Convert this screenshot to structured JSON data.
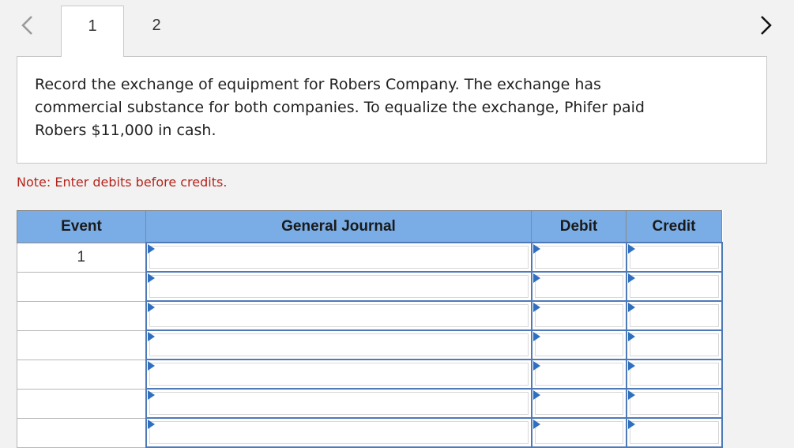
{
  "nav": {
    "prev_icon": "chevron-left-icon",
    "next_icon": "chevron-right-icon"
  },
  "tabs": [
    {
      "label": "1",
      "active": true
    },
    {
      "label": "2",
      "active": false
    }
  ],
  "question": {
    "text": "Record the exchange of equipment for Robers Company. The exchange has commercial substance for both companies. To equalize the exchange, Phifer paid Robers $11,000 in cash."
  },
  "note": "Note: Enter debits before credits.",
  "journal": {
    "headers": {
      "event": "Event",
      "general_journal": "General Journal",
      "debit": "Debit",
      "credit": "Credit"
    },
    "rows": [
      {
        "event": "1",
        "account": "",
        "debit": "",
        "credit": ""
      },
      {
        "event": "",
        "account": "",
        "debit": "",
        "credit": ""
      },
      {
        "event": "",
        "account": "",
        "debit": "",
        "credit": ""
      },
      {
        "event": "",
        "account": "",
        "debit": "",
        "credit": ""
      },
      {
        "event": "",
        "account": "",
        "debit": "",
        "credit": ""
      },
      {
        "event": "",
        "account": "",
        "debit": "",
        "credit": ""
      },
      {
        "event": "",
        "account": "",
        "debit": "",
        "credit": ""
      }
    ]
  },
  "colors": {
    "header_bg": "#7aade6",
    "input_border": "#4f7ab8",
    "note_text": "#b5251d"
  }
}
